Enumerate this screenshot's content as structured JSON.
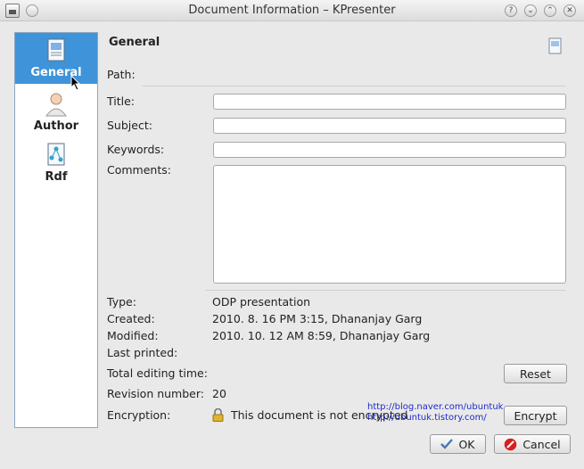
{
  "window": {
    "title": "Document Information – KPresenter"
  },
  "titlebar": {
    "help_glyph": "?",
    "menu_glyph": "⌄",
    "max_glyph": "⌃",
    "close_glyph": "✕"
  },
  "sidebar": {
    "items": [
      {
        "label": "General",
        "icon": "document-properties-icon",
        "active": true
      },
      {
        "label": "Author",
        "icon": "user-avatar-icon",
        "active": false
      },
      {
        "label": "Rdf",
        "icon": "rdf-graph-icon",
        "active": false
      }
    ]
  },
  "page": {
    "heading": "General",
    "path_label": "Path:",
    "title_label": "Title:",
    "subject_label": "Subject:",
    "keywords_label": "Keywords:",
    "comments_label": "Comments:",
    "title_value": "",
    "subject_value": "",
    "keywords_value": "",
    "comments_value": ""
  },
  "info": {
    "type_label": "Type:",
    "type_value": "ODP presentation",
    "created_label": "Created:",
    "created_value": "2010. 8. 16 PM 3:15, Dhananjay Garg",
    "modified_label": "Modified:",
    "modified_value": "2010. 10. 12 AM 8:59, Dhananjay Garg",
    "last_printed_label": "Last printed:",
    "total_editing_label": "Total editing time:",
    "revision_label": "Revision number:",
    "revision_value": "20",
    "encryption_label": "Encryption:",
    "encryption_value": "This document is not encrypted"
  },
  "buttons": {
    "reset": "Reset",
    "encrypt": "Encrypt",
    "ok": "OK",
    "cancel": "Cancel"
  },
  "watermark": {
    "line1": "http://blog.naver.com/ubuntuk",
    "line2": "http://ubuntuk.tistory.com/"
  },
  "colors": {
    "selection": "#3f93d8",
    "watermark": "#1d2bc8",
    "cancel_icon": "#d42020",
    "ok_icon": "#4a78b0"
  }
}
